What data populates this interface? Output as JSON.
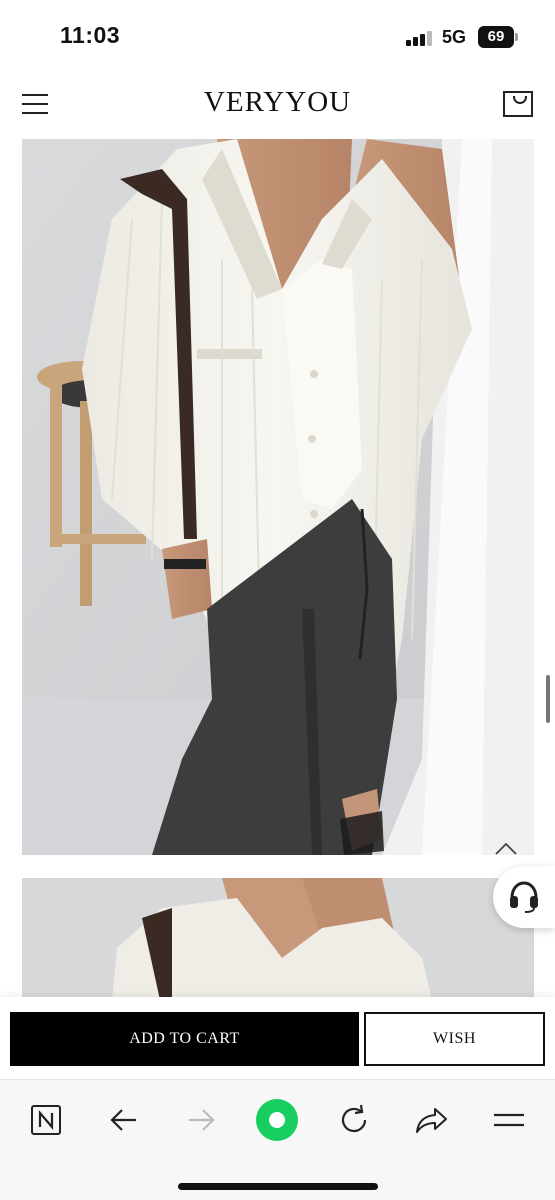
{
  "status_bar": {
    "time": "11:03",
    "network": "5G",
    "battery": "69"
  },
  "header": {
    "brand": "VERYYOU",
    "menu_icon": "hamburger-menu-icon",
    "cart_icon": "shopping-bag-icon"
  },
  "actions": {
    "add_to_cart_label": "ADD TO CART",
    "wish_label": "WISH"
  },
  "floating": {
    "scroll_top_icon": "chevron-up-icon",
    "support_icon": "headset-icon"
  },
  "browser_nav": {
    "icons": [
      "naver-n-icon",
      "back-arrow-icon",
      "forward-arrow-icon",
      "green-circle-home-icon",
      "reload-icon",
      "share-icon",
      "menu-lines-icon"
    ],
    "accent_color": "#19ce60"
  }
}
